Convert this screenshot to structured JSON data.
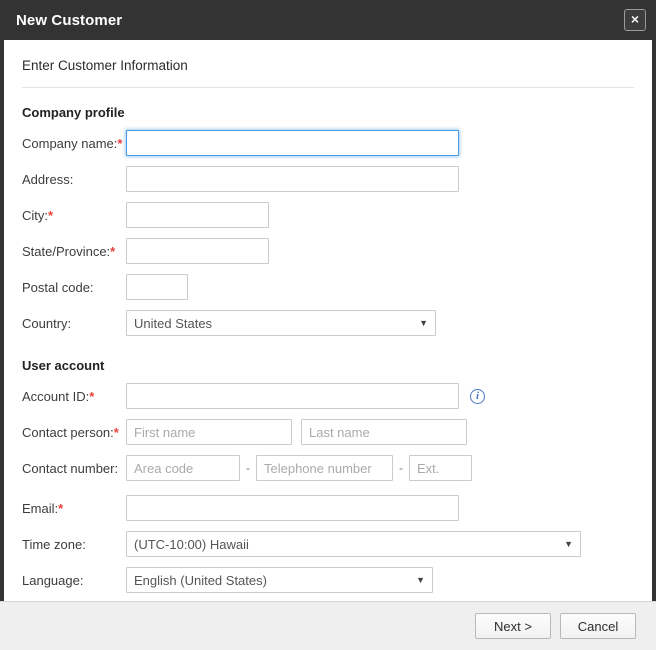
{
  "window": {
    "title": "New Customer",
    "close_label": "×",
    "close_icon": "close-icon"
  },
  "intro": "Enter Customer Information",
  "sections": {
    "company": {
      "heading": "Company profile",
      "fields": {
        "company_name": {
          "label": "Company name:",
          "required": "*",
          "value": "",
          "placeholder": ""
        },
        "address": {
          "label": "Address:",
          "required": "",
          "value": "",
          "placeholder": ""
        },
        "city": {
          "label": "City:",
          "required": "*",
          "value": "",
          "placeholder": ""
        },
        "state": {
          "label": "State/Province:",
          "required": "*",
          "value": "",
          "placeholder": ""
        },
        "postal": {
          "label": "Postal code:",
          "required": "",
          "value": "",
          "placeholder": ""
        },
        "country": {
          "label": "Country:",
          "required": "",
          "value": "United States",
          "caret": "▼"
        }
      }
    },
    "user": {
      "heading": "User account",
      "fields": {
        "account_id": {
          "label": "Account ID:",
          "required": "*",
          "value": "",
          "placeholder": "",
          "info_icon": "info-icon",
          "info_glyph": "i"
        },
        "contact_person": {
          "label": "Contact person:",
          "required": "*",
          "first": {
            "value": "",
            "placeholder": "First name"
          },
          "last": {
            "value": "",
            "placeholder": "Last name"
          }
        },
        "contact_number": {
          "label": "Contact number:",
          "required": "",
          "area": {
            "value": "",
            "placeholder": "Area code"
          },
          "tel": {
            "value": "",
            "placeholder": "Telephone number"
          },
          "ext": {
            "value": "",
            "placeholder": "Ext."
          },
          "separator": "-"
        },
        "email": {
          "label": "Email:",
          "required": "*",
          "value": "",
          "placeholder": ""
        },
        "timezone": {
          "label": "Time zone:",
          "required": "",
          "value": "(UTC-10:00) Hawaii",
          "caret": "▼"
        },
        "language": {
          "label": "Language:",
          "required": "",
          "value": "English (United States)",
          "caret": "▼"
        }
      }
    }
  },
  "footer": {
    "next_label": "Next >",
    "cancel_label": "Cancel"
  },
  "colors": {
    "titlebar_bg": "#333333",
    "required_star": "#e8413c",
    "focus_ring": "#4a9ae4",
    "info_icon": "#3a6cbe",
    "footer_bg": "#efefef"
  }
}
